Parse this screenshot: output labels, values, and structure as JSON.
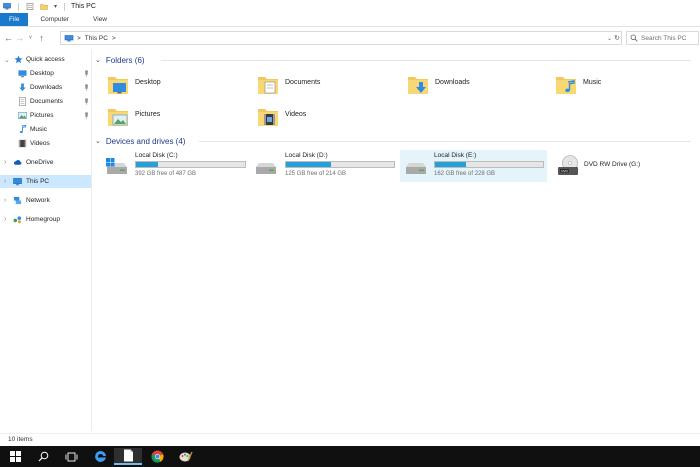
{
  "window": {
    "title": "This PC"
  },
  "ribbon": {
    "tabs": [
      "File",
      "Computer",
      "View"
    ]
  },
  "address": {
    "crumbs": [
      "This PC"
    ],
    "separator": ">"
  },
  "search": {
    "placeholder": "Search This PC"
  },
  "nav": {
    "items": [
      {
        "label": "Quick access",
        "icon": "star-icon"
      },
      {
        "label": "Desktop",
        "icon": "desktop-icon"
      },
      {
        "label": "Downloads",
        "icon": "downloads-icon"
      },
      {
        "label": "Documents",
        "icon": "documents-icon"
      },
      {
        "label": "Pictures",
        "icon": "pictures-icon"
      },
      {
        "label": "Music",
        "icon": "music-icon"
      },
      {
        "label": "Videos",
        "icon": "videos-icon"
      },
      {
        "label": "OneDrive",
        "icon": "cloud-icon"
      },
      {
        "label": "This PC",
        "icon": "computer-icon"
      },
      {
        "label": "Network",
        "icon": "network-icon"
      },
      {
        "label": "Homegroup",
        "icon": "homegroup-icon"
      }
    ]
  },
  "groups": {
    "folders_header": "Folders (6)",
    "drives_header": "Devices and drives (4)"
  },
  "folders": [
    {
      "label": "Desktop"
    },
    {
      "label": "Documents"
    },
    {
      "label": "Downloads"
    },
    {
      "label": "Music"
    },
    {
      "label": "Pictures"
    },
    {
      "label": "Videos"
    }
  ],
  "drives": [
    {
      "name": "Local Disk (C:)",
      "free_text": "392 GB free of 487 GB",
      "used_fraction": 0.2
    },
    {
      "name": "Local Disk (D:)",
      "free_text": "125 GB free of 214 GB",
      "used_fraction": 0.42
    },
    {
      "name": "Local Disk (E:)",
      "free_text": "162 GB free of 228 GB",
      "used_fraction": 0.29
    },
    {
      "name": "DVD RW Drive (G:)"
    }
  ],
  "status": {
    "count": "10 items"
  },
  "colors": {
    "accent": "#1979ca",
    "bar_fill": "#26a0da",
    "selection": "#cce8ff"
  }
}
